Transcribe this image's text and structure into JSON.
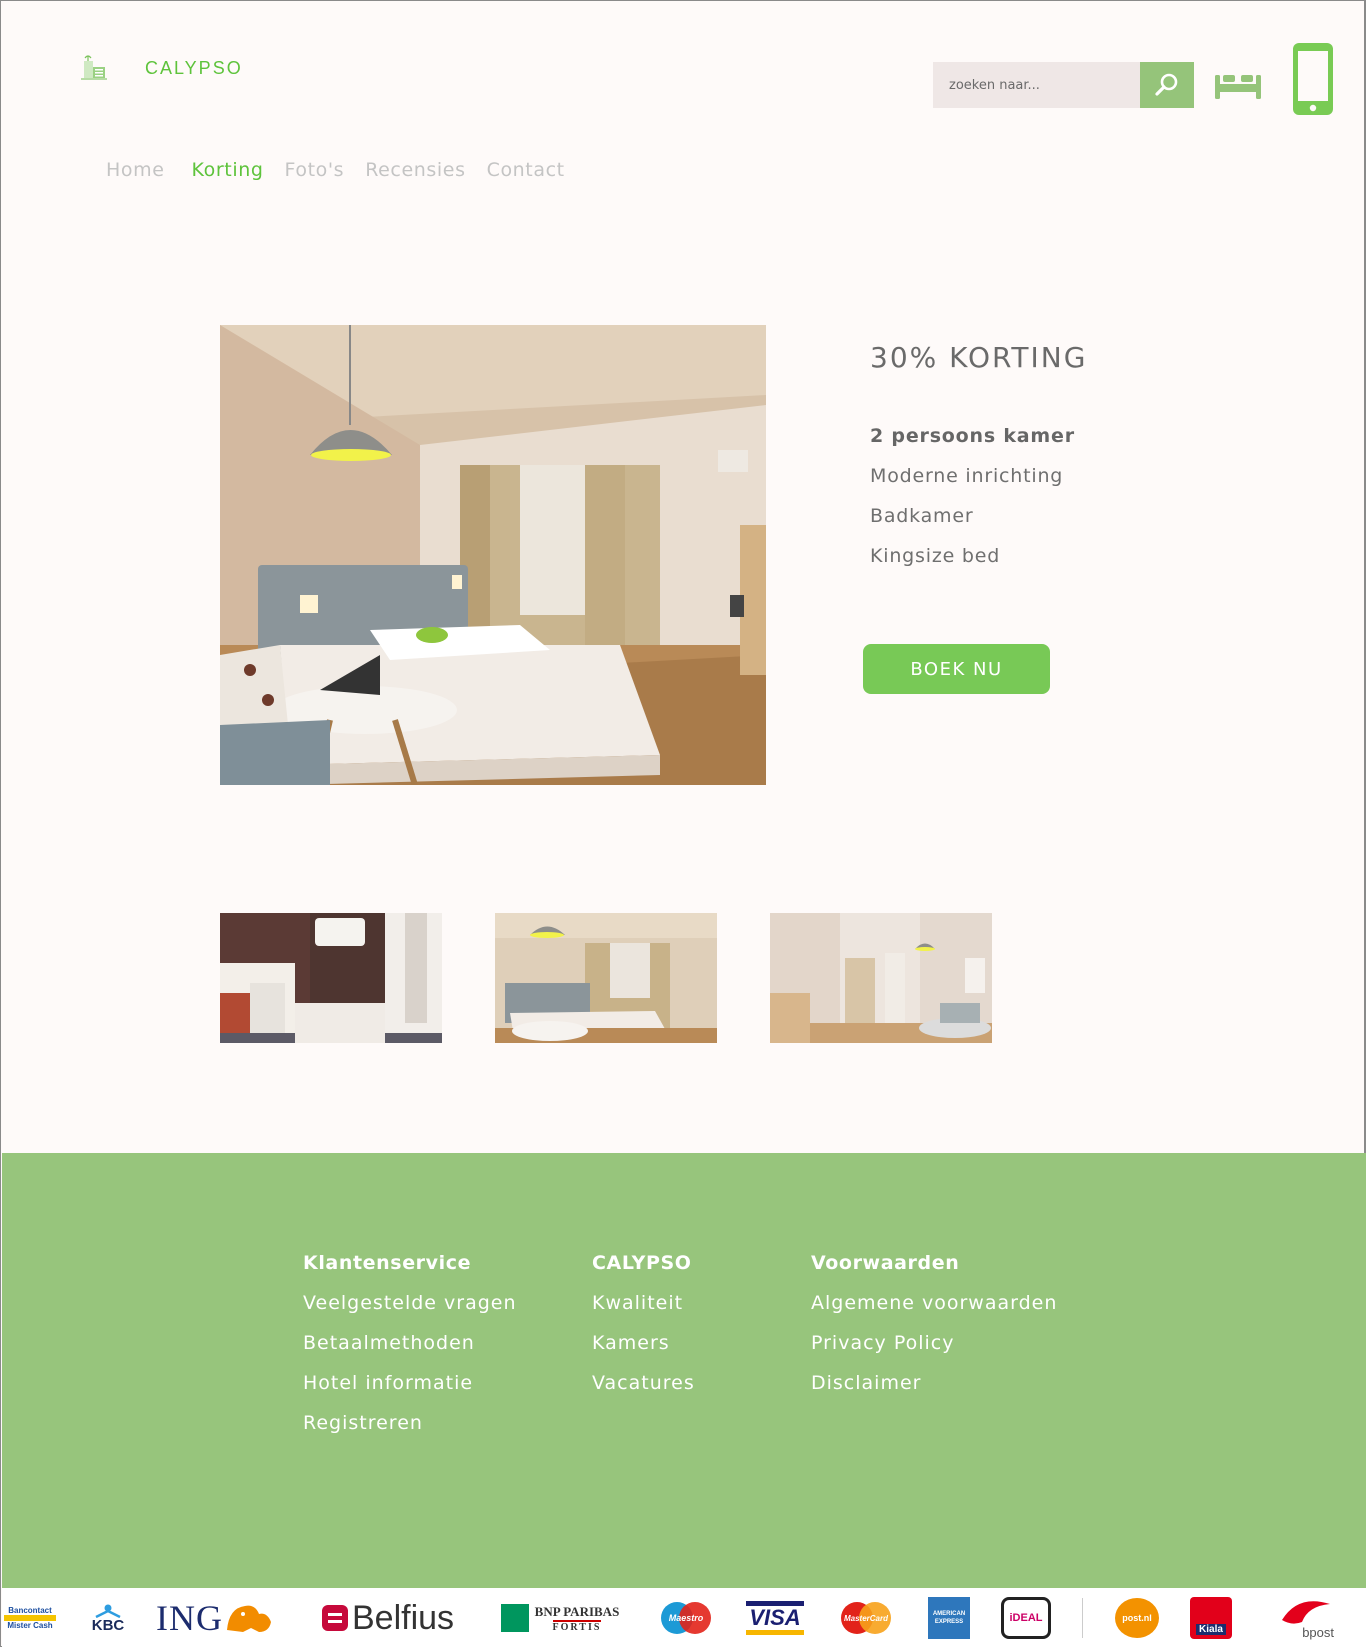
{
  "header": {
    "brand": "CALYPSO",
    "search_placeholder": "zoeken naar...",
    "icons": [
      "hotel-logo-icon",
      "search-icon",
      "bed-icon",
      "mobile-phone-icon"
    ]
  },
  "nav": {
    "items": [
      {
        "label": "Home",
        "active": false
      },
      {
        "label": "Korting",
        "active": true
      },
      {
        "label": "Foto's",
        "active": false
      },
      {
        "label": "Recensies",
        "active": false
      },
      {
        "label": "Contact",
        "active": false
      }
    ]
  },
  "offer": {
    "title": "30% KORTING",
    "features": [
      "2 persoons kamer",
      "Moderne inrichting",
      "Badkamer",
      "Kingsize bed"
    ],
    "book_label": "BOEK NU"
  },
  "footer": {
    "columns": [
      {
        "heading": "Klantenservice",
        "links": [
          "Veelgestelde vragen",
          "Betaalmethoden",
          "Hotel informatie",
          "Registreren"
        ]
      },
      {
        "heading": "CALYPSO",
        "links": [
          "Kwaliteit",
          "Kamers",
          "Vacatures"
        ]
      },
      {
        "heading": "Voorwaarden",
        "links": [
          "Algemene voorwaarden",
          "Privacy Policy",
          "Disclaimer"
        ]
      }
    ]
  },
  "payments": {
    "bancontact": {
      "line1": "Bancontact",
      "line2": "Mister Cash"
    },
    "kbc": "KBC",
    "ing": "ING",
    "belfius": "Belfius",
    "bnp": {
      "line1": "BNP PARIBAS",
      "line2": "FORTIS"
    },
    "maestro": "Maestro",
    "visa": "VISA",
    "mastercard": "MasterCard",
    "amex": "AMERICAN EXPRESS",
    "ideal": "iDEAL",
    "postnl": "post.nl",
    "kiala": "Kiala",
    "bpost": "bpost"
  },
  "colors": {
    "accent": "#5ec33c",
    "button": "#78c956",
    "footer": "#97c57c",
    "search_button": "#95c47a",
    "background": "#fefaf9"
  }
}
